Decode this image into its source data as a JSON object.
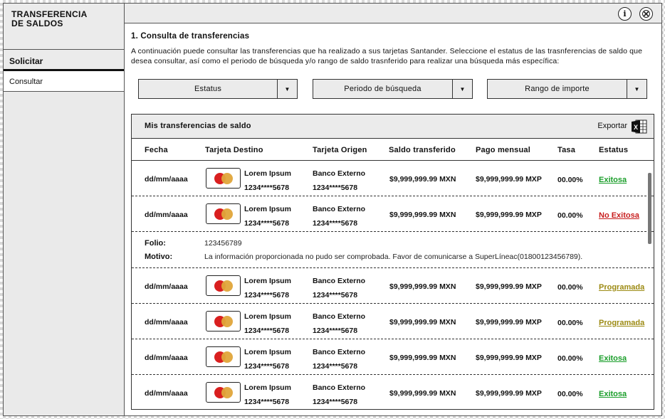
{
  "sidebar": {
    "title": "TRANSFERENCIA\nDE SALDOS",
    "items": [
      {
        "label": "Solicitar"
      },
      {
        "label": "Consultar"
      }
    ]
  },
  "topbar": {
    "info_icon": "info-icon",
    "close_icon": "close-icon"
  },
  "main": {
    "section_title": "1. Consulta de transferencias",
    "section_desc": "A continuación puede consultar las transferencias que ha realizado a sus tarjetas Santander. Seleccione el estatus de las trasnferencias de saldo que desea consultar, así como el periodo de búsqueda y/o rango de saldo trasnferido para realizar una búsqueda más específica:"
  },
  "filters": [
    {
      "label": "Estatus"
    },
    {
      "label": "Periodo de búsqueda"
    },
    {
      "label": "Rango de importe"
    }
  ],
  "panel": {
    "title": "Mis transferencias de saldo",
    "export_label": "Exportar",
    "export_icon": "excel-icon",
    "columns": [
      "Fecha",
      "Tarjeta Destino",
      "Tarjeta Origen",
      "Saldo transferido",
      "Pago mensual",
      "Tasa",
      "Estatus"
    ]
  },
  "rows": [
    {
      "date": "dd/mm/aaaa",
      "dest_name": "Lorem Ipsum",
      "dest_num": "1234****5678",
      "orig_name": "Banco Externo",
      "orig_num": "1234****5678",
      "saldo": "$9,999,999.99 MXN",
      "pago": "$9,999,999.99 MXP",
      "tasa": "00.00%",
      "status": "Exitosa",
      "status_color": "#1a9e2a"
    },
    {
      "date": "dd/mm/aaaa",
      "dest_name": "Lorem Ipsum",
      "dest_num": "1234****5678",
      "orig_name": "Banco Externo",
      "orig_num": "1234****5678",
      "saldo": "$9,999,999.99 MXN",
      "pago": "$9,999,999.99 MXP",
      "tasa": "00.00%",
      "status": "No Exitosa",
      "status_color": "#c81e1e"
    },
    {
      "date": "dd/mm/aaaa",
      "dest_name": "Lorem Ipsum",
      "dest_num": "1234****5678",
      "orig_name": "Banco Externo",
      "orig_num": "1234****5678",
      "saldo": "$9,999,999.99 MXN",
      "pago": "$9,999,999.99 MXP",
      "tasa": "00.00%",
      "status": "Programada",
      "status_color": "#9c8a12"
    },
    {
      "date": "dd/mm/aaaa",
      "dest_name": "Lorem Ipsum",
      "dest_num": "1234****5678",
      "orig_name": "Banco Externo",
      "orig_num": "1234****5678",
      "saldo": "$9,999,999.99 MXN",
      "pago": "$9,999,999.99 MXP",
      "tasa": "00.00%",
      "status": "Programada",
      "status_color": "#9c8a12"
    },
    {
      "date": "dd/mm/aaaa",
      "dest_name": "Lorem Ipsum",
      "dest_num": "1234****5678",
      "orig_name": "Banco Externo",
      "orig_num": "1234****5678",
      "saldo": "$9,999,999.99 MXN",
      "pago": "$9,999,999.99 MXP",
      "tasa": "00.00%",
      "status": "Exitosa",
      "status_color": "#1a9e2a"
    },
    {
      "date": "dd/mm/aaaa",
      "dest_name": "Lorem Ipsum",
      "dest_num": "1234****5678",
      "orig_name": "Banco Externo",
      "orig_num": "1234****5678",
      "saldo": "$9,999,999.99 MXN",
      "pago": "$9,999,999.99 MXP",
      "tasa": "00.00%",
      "status": "Exitosa",
      "status_color": "#1a9e2a"
    }
  ],
  "detail": {
    "folio_label": "Folio:",
    "folio_value": "123456789",
    "motivo_label": "Motivo:",
    "motivo_value": "La información proporcionada no pudo ser comprobada. Favor de comunicarse a SuperLíneac(01800123456789)."
  }
}
